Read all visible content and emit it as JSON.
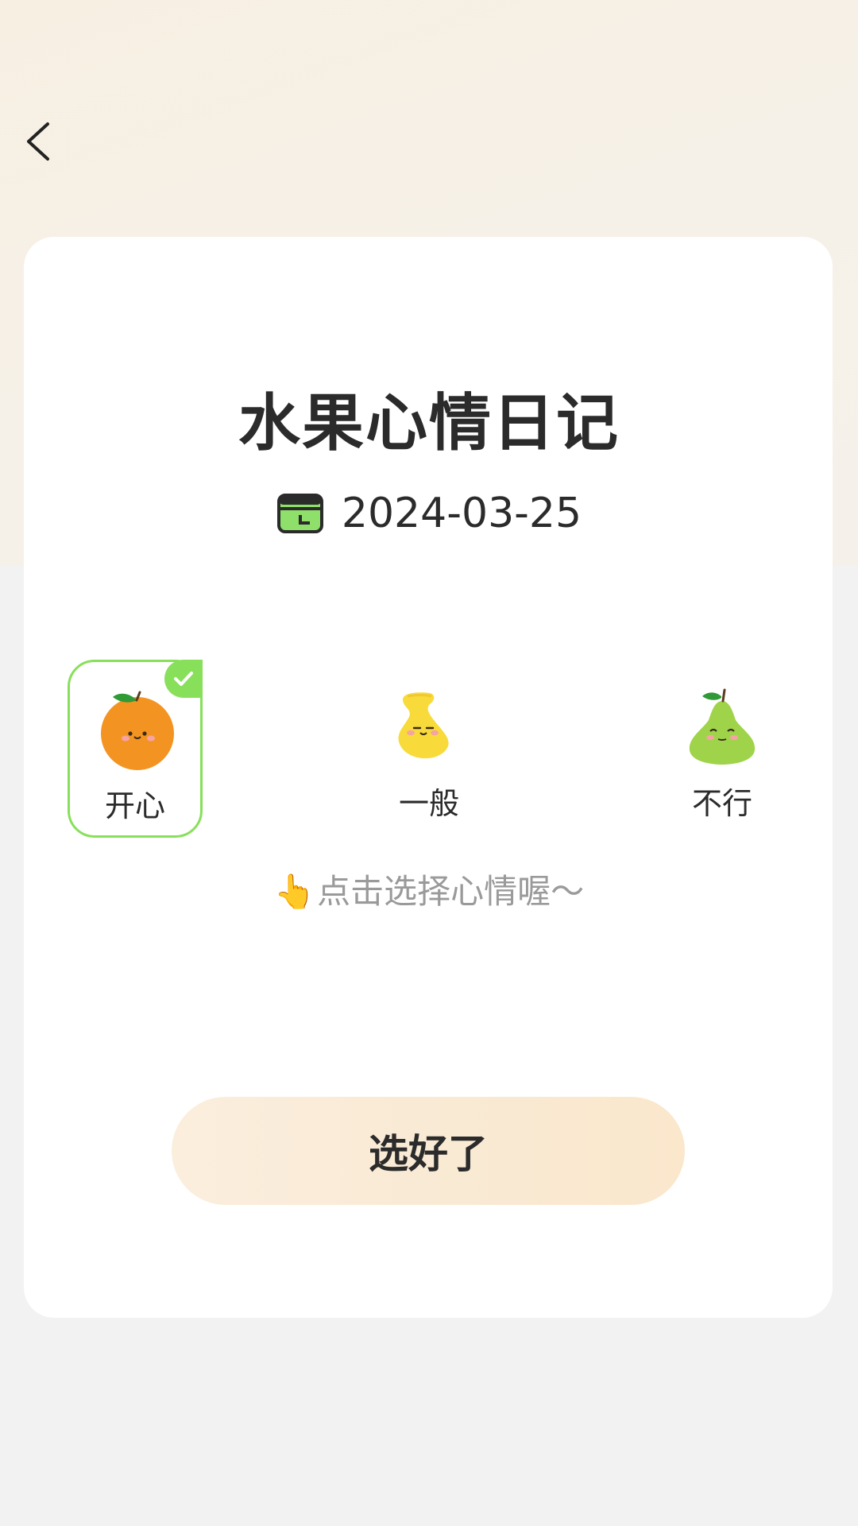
{
  "header": {
    "back_icon": "chevron-left-icon"
  },
  "card": {
    "title": "水果心情日记",
    "date_icon": "calendar-icon",
    "date": "2024-03-25",
    "moods": [
      {
        "label": "开心",
        "icon": "orange-icon",
        "selected": true
      },
      {
        "label": "一般",
        "icon": "banana-icon",
        "selected": false
      },
      {
        "label": "不行",
        "icon": "pear-icon",
        "selected": false
      }
    ],
    "hint_emoji": "👆",
    "hint_text": "点击选择心情喔～",
    "confirm_label": "选好了"
  },
  "colors": {
    "accent_green": "#88e05a",
    "button_bg": "#fbeedd",
    "text_dark": "#2b2b2b",
    "hint_gray": "#9a9a9a"
  }
}
